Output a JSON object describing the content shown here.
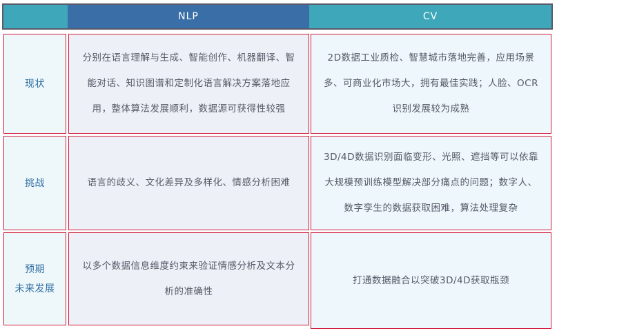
{
  "header": {
    "corner": "",
    "nlp": "NLP",
    "cv": "CV"
  },
  "rows": [
    {
      "label": "现状",
      "nlp": "分别在语言理解与生成、智能创作、机器翻译、智能对话、知识图谱和定制化语言解决方案落地应用，整体算法发展顺利，数据源可获得性较强",
      "cv": "2D数据工业质检、智慧城市落地完善，应用场景多、可商业化市场大，拥有最佳实践；人脸、OCR识别发展较为成熟"
    },
    {
      "label": "挑战",
      "nlp": "语言的歧义、文化差异及多样化、情感分析困难",
      "cv": "3D/4D数据识别面临变形、光照、遮挡等可以依靠大规模预训练模型解决部分痛点的问题；数字人、数字孪生的数据获取困难，算法处理复杂"
    },
    {
      "label": "预期\n未来发展",
      "label_line1": "预期",
      "label_line2": "未来发展",
      "nlp": "以多个数据信息维度约束来验证情感分析及文本分析的准确性",
      "cv": "打通数据融合以突破3D/4D获取瓶颈"
    }
  ]
}
